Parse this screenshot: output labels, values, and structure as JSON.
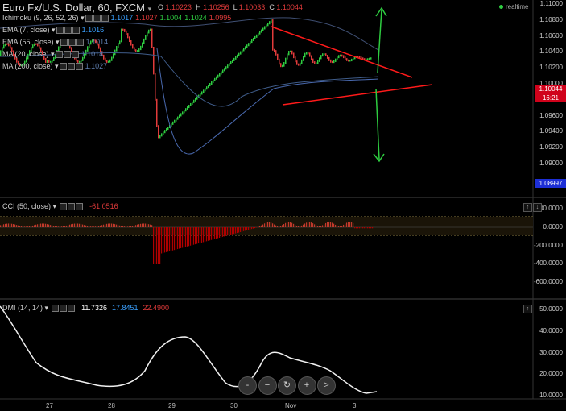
{
  "header": {
    "title": "Euro Fx/U.S. Dollar, 60, FXCM",
    "ohlc": [
      {
        "k": "O",
        "v": "1.10223"
      },
      {
        "k": "H",
        "v": "1.10256"
      },
      {
        "k": "L",
        "v": "1.10033"
      },
      {
        "k": "C",
        "v": "1.10044"
      }
    ],
    "realtime": "realtime"
  },
  "studies": [
    {
      "label": "Ichimoku (9, 26, 52, 26)",
      "values": [
        "1.1017",
        "1.1027",
        "1.1004",
        "1.1024",
        "1.0995"
      ],
      "colors": [
        "#3aa0ff",
        "#e23b3b",
        "#2ecc40",
        "#2ecc40",
        "#e23b3b"
      ]
    },
    {
      "label": "EMA (7, close)",
      "values": [
        "1.1016"
      ],
      "colors": [
        "#3aa0ff"
      ]
    },
    {
      "label": "EMA (55, close)",
      "values": [
        "1.1014"
      ],
      "colors": [
        "#5f7fb0"
      ]
    },
    {
      "label": "MA (20, close)",
      "values": [
        "1.1014"
      ],
      "colors": [
        "#5f7fb0"
      ]
    },
    {
      "label": "MA (200, close)",
      "values": [
        "1.1027"
      ],
      "colors": [
        "#5f7fb0"
      ]
    }
  ],
  "price_axis": [
    "1.11000",
    "1.10800",
    "1.10600",
    "1.10400",
    "1.10200",
    "1.10000",
    "1.09800",
    "1.09600",
    "1.09400",
    "1.09200",
    "1.09000"
  ],
  "price_tags": [
    {
      "value": "1.10044",
      "color": "#d0021b"
    },
    {
      "value": "16:21",
      "color": "#d0021b"
    },
    {
      "value": "1.08997",
      "color": "#1d2fd6"
    }
  ],
  "cci": {
    "label": "CCI (50, close)",
    "value": "-61.0516",
    "axis": [
      "200.0000",
      "0.0000",
      "-200.0000",
      "-400.0000",
      "-600.0000"
    ]
  },
  "dmi": {
    "label": "DMI (14, 14)",
    "values": [
      "11.7326",
      "17.8451",
      "22.4900"
    ],
    "colors": [
      "#ffffff",
      "#3aa0ff",
      "#e23b3b"
    ],
    "axis": [
      "50.0000",
      "40.0000",
      "30.0000",
      "20.0000",
      "10.0000"
    ]
  },
  "x_axis": [
    "27",
    "28",
    "29",
    "30",
    "Nov",
    "3"
  ],
  "nav_buttons": [
    "-",
    "−",
    "↻",
    "+",
    ">"
  ],
  "colors": {
    "up": "#2ecc40",
    "down": "#e23b3b",
    "triangle": "#ff1a1a",
    "arrow": "#2ecc40"
  }
}
